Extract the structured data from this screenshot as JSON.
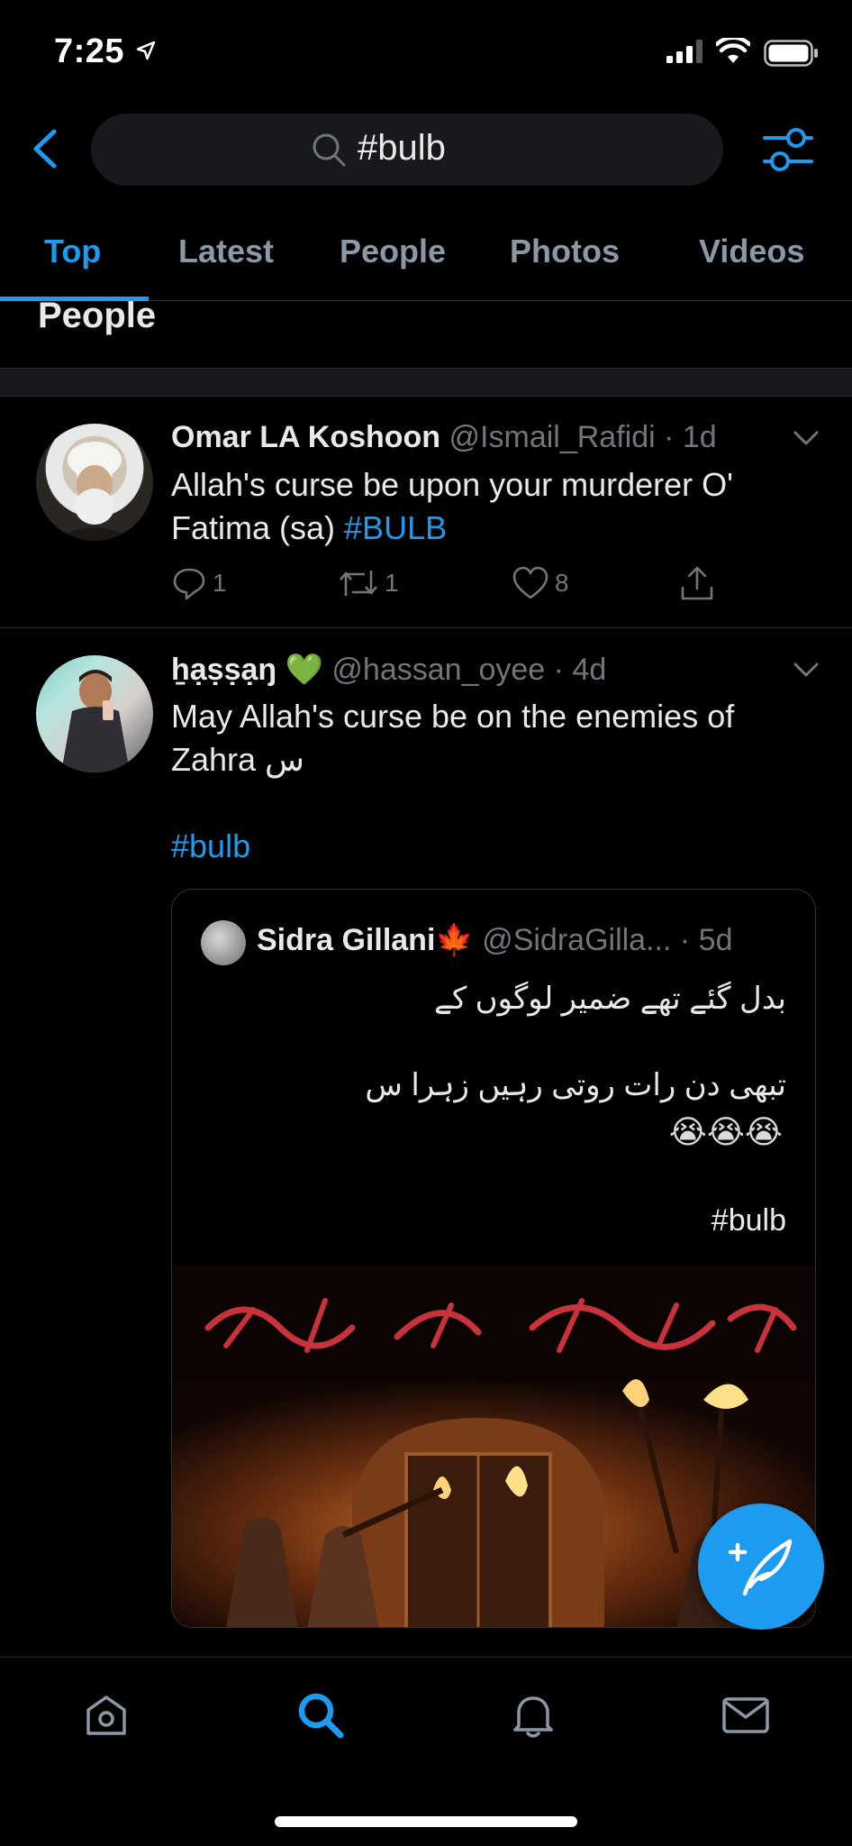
{
  "status": {
    "time": "7:25"
  },
  "search": {
    "query": "#bulb"
  },
  "tabs": [
    {
      "label": "Top"
    },
    {
      "label": "Latest"
    },
    {
      "label": "People"
    },
    {
      "label": "Photos"
    },
    {
      "label": "Videos"
    }
  ],
  "section": {
    "heading": "People"
  },
  "tweets": [
    {
      "name": "Omar LA Koshoon",
      "handle": "@Ismail_Rafidi",
      "time": "· 1d",
      "text_line1": "Allah's curse be upon your murderer O'",
      "text_line2": "Fatima (sa) ",
      "hashtag": "#BULB",
      "replies": "1",
      "retweets": "1",
      "likes": "8"
    },
    {
      "name": "ẖạṣṣạŋ 💚",
      "handle": "@hassan_oyee",
      "time": "· 4d",
      "text_line1": "May Allah's curse be on the enemies of",
      "text_line2": "Zahra س",
      "hashtag": "#bulb",
      "quote": {
        "name": "Sidra Gillani🍁",
        "handle": "@SidraGilla...",
        "time": "· 5d",
        "line1": "بدل گئے تھے ضمیر لوگوں کے",
        "line2": "تبھی دن رات روتی رہیں زہرا س",
        "emoji": "😭😭😭",
        "hashtag": "#bulb"
      }
    }
  ],
  "colors": {
    "accent": "#1d9bf0",
    "background": "#000000",
    "secondary_text": "#71767b"
  },
  "icons": [
    "location-arrow-icon",
    "signal-icon",
    "wifi-icon",
    "battery-icon",
    "back-chevron-icon",
    "search-icon",
    "filter-sliders-icon",
    "reply-icon",
    "retweet-icon",
    "like-icon",
    "share-icon",
    "compose-icon",
    "home-icon",
    "explore-icon",
    "notifications-icon",
    "messages-icon"
  ]
}
